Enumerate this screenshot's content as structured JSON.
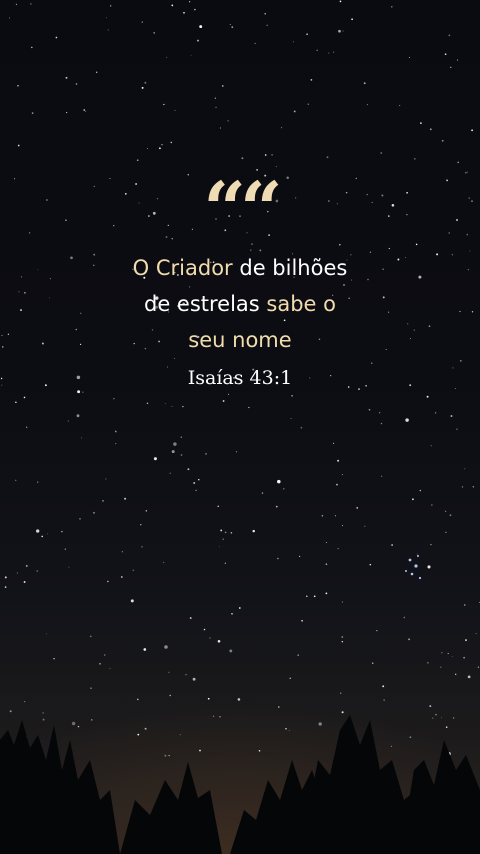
{
  "quote": {
    "mark": "“",
    "line1": {
      "hl": "O Criador",
      "rest": " de bilhões"
    },
    "line2": {
      "rest": "de estrelas ",
      "hl": "sabe o"
    },
    "line3": {
      "hl": "seu nome"
    }
  },
  "reference": "Isaías 43:1",
  "colors": {
    "sky_top": "#0a0b10",
    "horizon": "#2a2320",
    "accent": "#f1dcae",
    "text": "#ffffff",
    "trees": "#050608"
  }
}
